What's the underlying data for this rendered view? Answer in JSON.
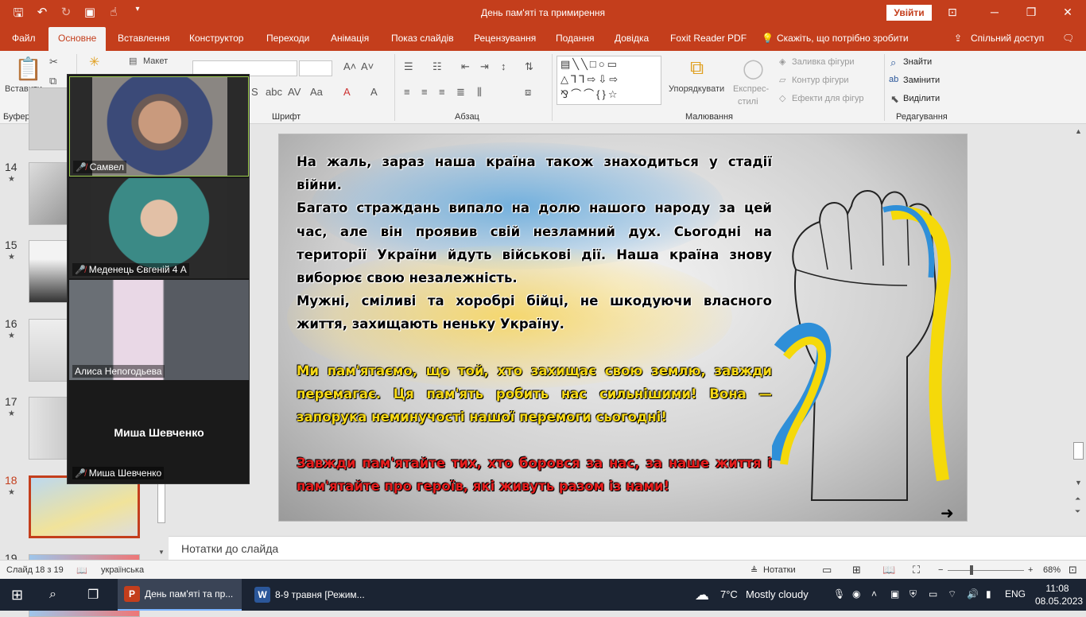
{
  "window": {
    "title": "День пам'яті та примирення",
    "signin_label": "Увійти"
  },
  "tabs": [
    {
      "label": "Файл"
    },
    {
      "label": "Основне"
    },
    {
      "label": "Вставлення"
    },
    {
      "label": "Конструктор"
    },
    {
      "label": "Переходи"
    },
    {
      "label": "Анімація"
    },
    {
      "label": "Показ слайдів"
    },
    {
      "label": "Рецензування"
    },
    {
      "label": "Подання"
    },
    {
      "label": "Довідка"
    },
    {
      "label": "Foxit Reader PDF"
    },
    {
      "label": "Скажіть, що потрібно зробити"
    },
    {
      "label": "Спільний доступ"
    }
  ],
  "ribbon": {
    "paste_label": "Вставити",
    "layout_label": "Макет",
    "arrange_label": "Упорядкувати",
    "quick_styles_label_1": "Експрес-",
    "quick_styles_label_2": "стилі",
    "shape_fill_label": "Заливка фігури",
    "shape_outline_label": "Контур фігури",
    "shape_effects_label": "Ефекти для фігур",
    "find_label": "Знайти",
    "replace_label": "Замінити",
    "select_label": "Виділити",
    "groups": {
      "clipboard": "Буфер обміну",
      "font": "Шрифт",
      "paragraph": "Абзац",
      "drawing": "Малювання",
      "editing": "Редагування"
    }
  },
  "thumbnails": [
    {
      "number": "14"
    },
    {
      "number": "15"
    },
    {
      "number": "16"
    },
    {
      "number": "17"
    },
    {
      "number": "18"
    },
    {
      "number": "19"
    }
  ],
  "slide": {
    "para1": "На жаль, зараз наша країна також знаходиться у стадії війни.",
    "para2": "Багато страждань випало на долю нашого народу за цей час, але він проявив свій незламний дух. Сьогодні на території України йдуть військові дії. Наша країна знову виборює свою незалежність.",
    "para3": "Мужні, сміливі та хоробрі бійці, не шкодуючи власного життя, захищають неньку Україну.",
    "para4": "Ми пам'ятаємо, що той, хто захищає свою землю, завжди перемагає. Ця пам'ять робить нас сильнішими! Вона — запорука неминучості нашої перемоги сьогодні!",
    "para5": "Завжди пам'ятайте тих, хто боровся за нас, за наше життя і пам'ятайте про героїв, які живуть разом із нами!",
    "colors": {
      "yellow": "#f7d917",
      "red": "#e61e1e",
      "ribbon_blue": "#2f8fd8",
      "ribbon_yellow": "#f5d90a"
    }
  },
  "notes": {
    "placeholder": "Нотатки до слайда"
  },
  "status": {
    "slide_counter": "Слайд 18 з 19",
    "language": "українська",
    "notes_button": "Нотатки",
    "zoom": "68%"
  },
  "video_call": {
    "participants": [
      {
        "name": "Самвел",
        "muted": true,
        "camera": true
      },
      {
        "name": "Меденець Євгеній 4 А",
        "muted": true,
        "camera": true
      },
      {
        "name": "Алиса Непогодьева",
        "muted": false,
        "camera": true
      },
      {
        "name": "Миша Шевченко",
        "muted": true,
        "camera": false,
        "display_name": "Миша Шевченко"
      }
    ]
  },
  "taskbar": {
    "apps": [
      {
        "label": "День пам'яті та пр...",
        "icon": "powerpoint-icon",
        "color": "#c43e1c"
      },
      {
        "label": "8-9 травня [Режим...",
        "icon": "word-icon",
        "color": "#2b579a"
      }
    ],
    "weather": {
      "temp": "7°C",
      "desc": "Mostly cloudy"
    },
    "lang": "ENG",
    "time": "11:08",
    "date": "08.05.2023"
  }
}
